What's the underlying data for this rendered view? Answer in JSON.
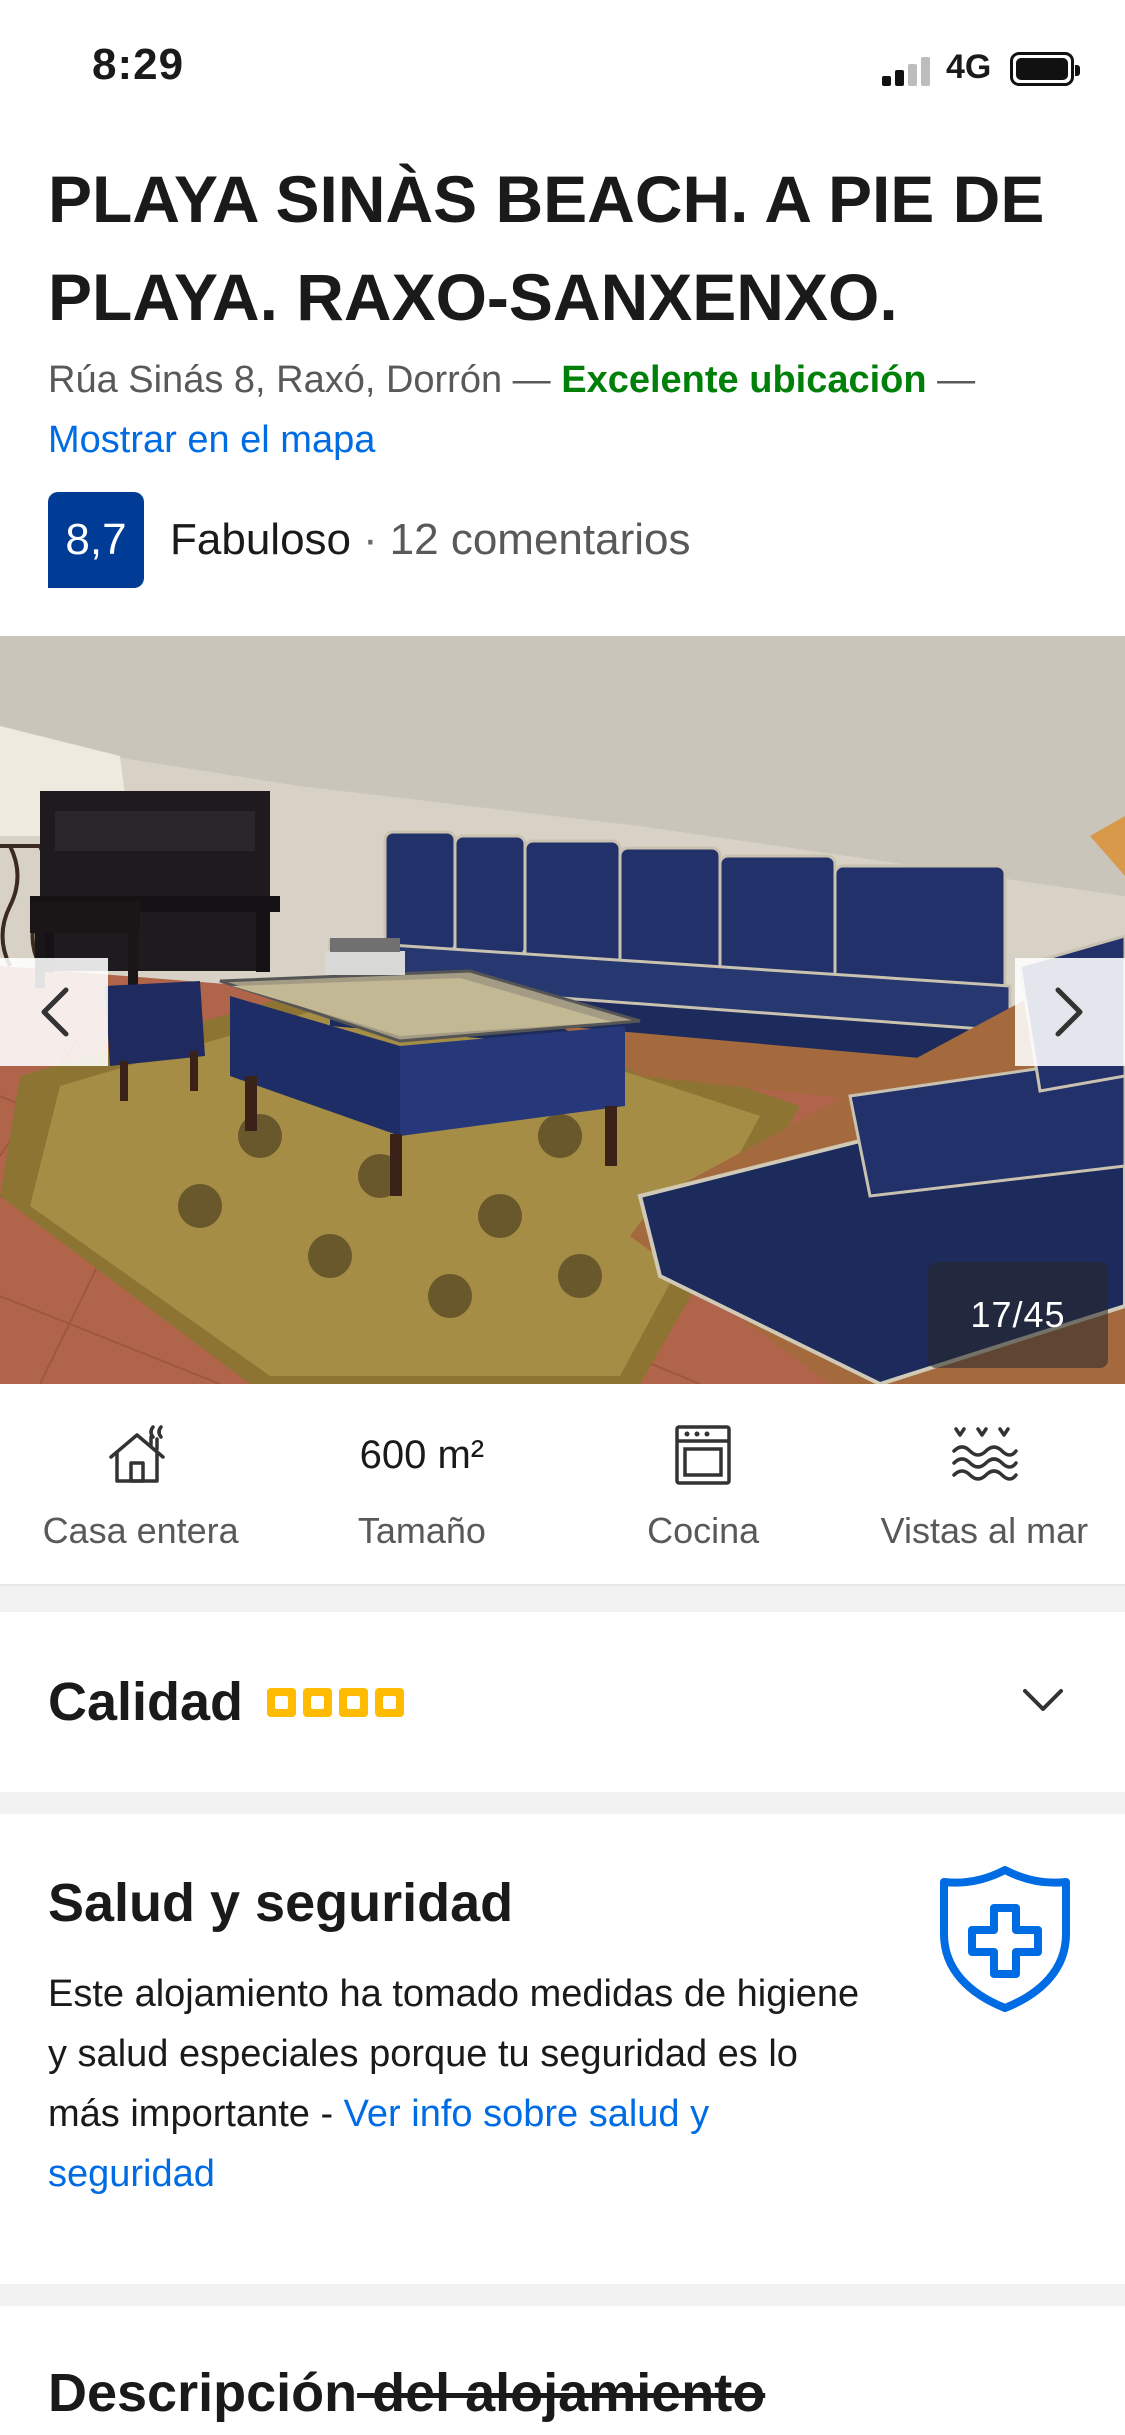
{
  "status_bar": {
    "time": "8:29",
    "network": "4G"
  },
  "property": {
    "title": "PLAYA SINÀS BEACH. A PIE DE PLAYA. RAXO-SANXENXO.",
    "address": "Rúa Sinás 8, Raxó, Dorrón — ",
    "location_badge": "Excelente ubicación",
    "address_sep": " — ",
    "map_link": "Mostrar en el mapa"
  },
  "rating": {
    "score": "8,7",
    "word": "Fabuloso",
    "dot": "·",
    "reviews": "12 comentarios"
  },
  "gallery": {
    "counter": "17/45"
  },
  "facilities": [
    {
      "icon": "house-icon",
      "label": "Casa entera"
    },
    {
      "value": "600 m²",
      "label": "Tamaño"
    },
    {
      "icon": "oven-icon",
      "label": "Cocina"
    },
    {
      "icon": "sea-view-icon",
      "label": "Vistas al mar"
    }
  ],
  "quality": {
    "title": "Calidad",
    "stars": 4
  },
  "health": {
    "title": "Salud y seguridad",
    "text": "Este alojamiento ha tomado medidas de higiene y salud especiales porque tu seguridad es lo más importante - ",
    "link": "Ver info sobre salud y seguridad"
  },
  "description": {
    "title_start": "Descripción",
    "title_struck": " del alojamiento"
  },
  "colors": {
    "brand_blue": "#003b95",
    "link_blue": "#006ce4",
    "success_green": "#008009",
    "star_yellow": "#febb02"
  }
}
